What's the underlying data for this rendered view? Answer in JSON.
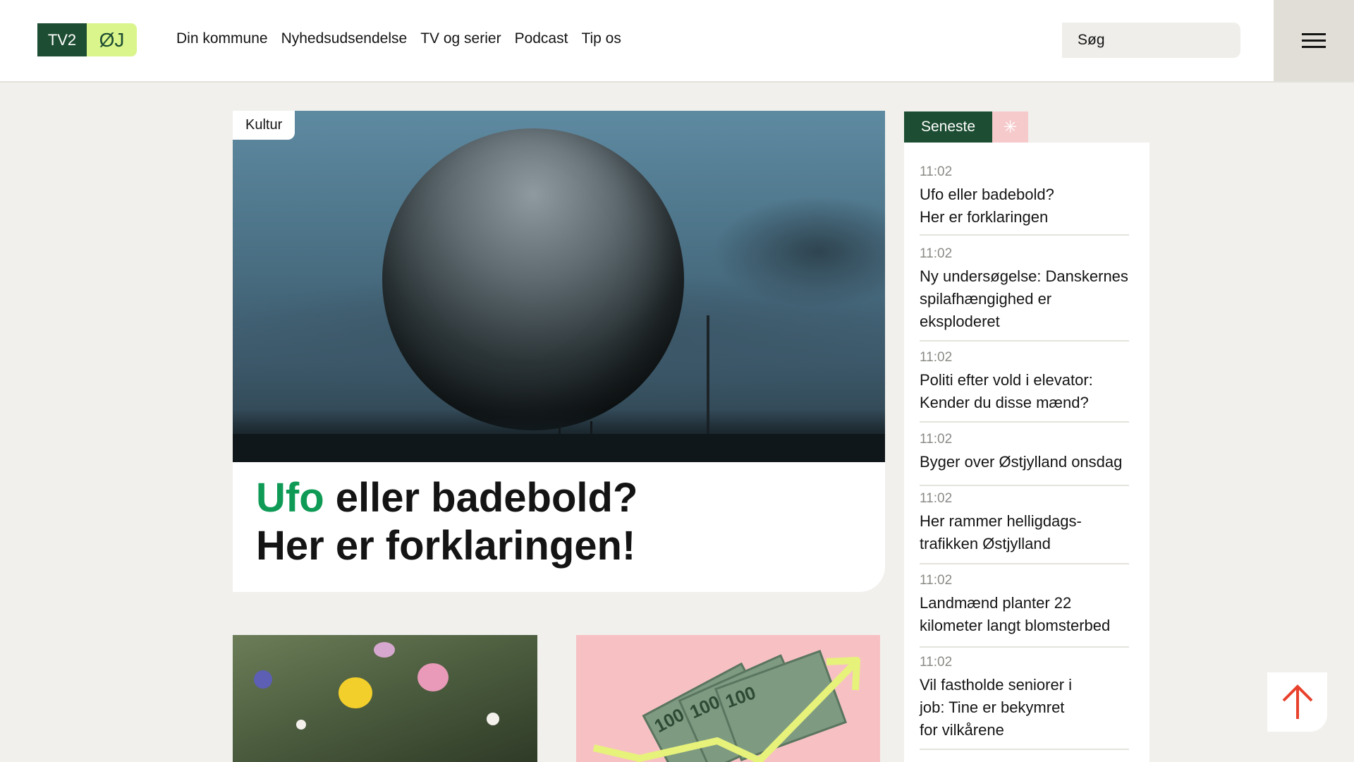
{
  "header": {
    "logo_left": "TV2",
    "logo_right": "ØJ",
    "nav": [
      "Din kommune",
      "Nyhedsudsendelse",
      "TV og serier",
      "Podcast",
      "Tip os"
    ],
    "search_placeholder": "Søg",
    "menu_icon": "hamburger-icon"
  },
  "hero": {
    "tag": "Kultur",
    "title_accent": "Ufo",
    "title_rest_line1": " eller badebold?",
    "title_line2": "Her er forklaringen!"
  },
  "cards": {
    "banknote_label": "100"
  },
  "sidebar": {
    "tab_label": "Seneste",
    "tab_icon": "asterisk-icon",
    "items": [
      {
        "time": "11:02",
        "text": "Ufo eller badebold? Her er forklaringen"
      },
      {
        "time": "11:02",
        "text": "Ny undersøgelse: Danskernes spilafhængighed er eksploderet"
      },
      {
        "time": "11:02",
        "text": "Politi efter vold i elevator: Kender du disse mænd?"
      },
      {
        "time": "11:02",
        "text": "Byger over Østjylland onsdag"
      },
      {
        "time": "11:02",
        "text": "Her rammer helligdags-trafikken Østjylland"
      },
      {
        "time": "11:02",
        "text": "Landmænd planter 22 kilometer langt blomsterbed"
      },
      {
        "time": "11:02",
        "text": "Vil fastholde seniorer i job: Tine er bekymret for vilkårene"
      }
    ]
  },
  "colors": {
    "brand_green": "#1d4d32",
    "lime": "#d9f58b",
    "accent_green": "#0f9a55",
    "pink": "#f7c1c4",
    "arrow_red": "#e8412c"
  },
  "scroll_top_icon": "arrow-up-icon"
}
